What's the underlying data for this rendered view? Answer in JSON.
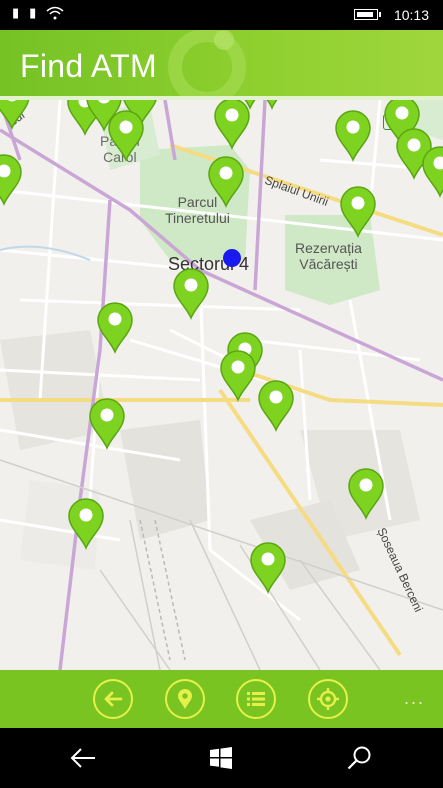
{
  "status_bar": {
    "icons": [
      "sim-1-icon",
      "sim-2-icon",
      "wifi-icon",
      "battery-icon"
    ],
    "time": "10:13"
  },
  "header": {
    "title": "Find ATM"
  },
  "map": {
    "labels": {
      "district": "Sectorul 4",
      "park": "Parcul\nTineretului",
      "reserve": "Rezervația\nVăcărești",
      "carol": "Parcul\nCarol",
      "splaiul": "Splaiul Unirii",
      "berceni": "Șoseaua Berceni",
      "corner": "sul"
    },
    "atm_pins": 24
  },
  "app_bar": {
    "buttons": [
      "back-icon",
      "location-pin-icon",
      "list-icon",
      "locate-me-icon"
    ],
    "more_label": "..."
  },
  "nav_bar": {
    "buttons": [
      "back-arrow-icon",
      "windows-start-icon",
      "search-icon"
    ]
  },
  "colors": {
    "brand_green": "#75c225",
    "pin_green": "#7ed321",
    "accent_yellow": "#e6f04a",
    "location_blue": "#1a1af0"
  }
}
